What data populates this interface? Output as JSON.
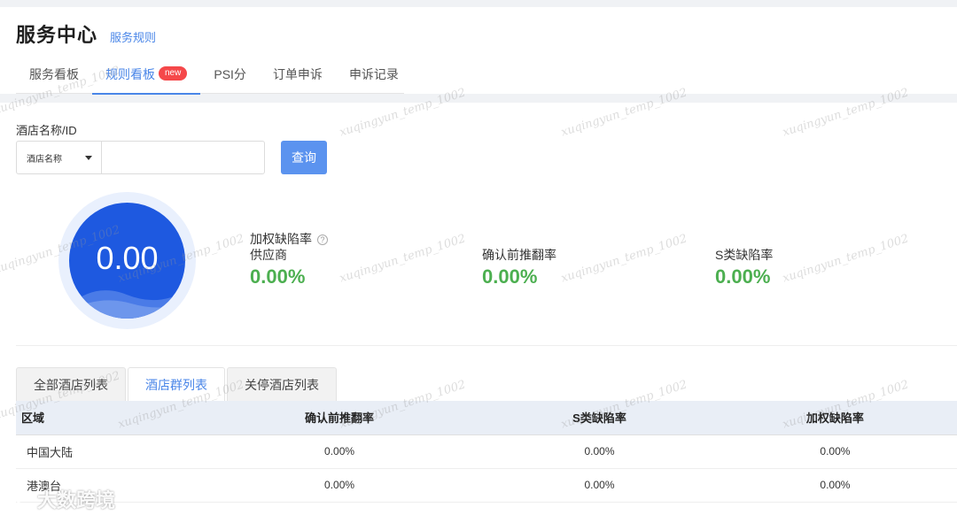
{
  "header": {
    "title": "服务中心",
    "rules_link": "服务规则",
    "tabs": [
      {
        "label": "服务看板"
      },
      {
        "label": "规则看板",
        "badge": "new"
      },
      {
        "label": "PSI分"
      },
      {
        "label": "订单申诉"
      },
      {
        "label": "申诉记录"
      }
    ],
    "active_tab": "规则看板"
  },
  "search": {
    "label": "酒店名称/ID",
    "select_value": "酒店名称",
    "input_value": "",
    "button_label": "查询"
  },
  "score": {
    "value": "0.00"
  },
  "metrics": {
    "weighted_title": "加权缺陷率",
    "items": [
      {
        "label": "供应商",
        "value": "0.00%"
      },
      {
        "label": "确认前推翻率",
        "value": "0.00%"
      },
      {
        "label": "S类缺陷率",
        "value": "0.00%"
      }
    ]
  },
  "sub_tabs": [
    {
      "label": "全部酒店列表"
    },
    {
      "label": "酒店群列表"
    },
    {
      "label": "关停酒店列表"
    }
  ],
  "table": {
    "headers": [
      "区域",
      "确认前推翻率",
      "S类缺陷率",
      "加权缺陷率"
    ],
    "rows": [
      [
        "中国大陆",
        "0.00%",
        "0.00%",
        "0.00%"
      ],
      [
        "港澳台",
        "0.00%",
        "0.00%",
        "0.00%"
      ]
    ]
  },
  "watermark": "xuqingyun_temp_1002",
  "footer_logo": "大数跨境",
  "colors": {
    "accent": "#4a86e8",
    "score_circle": "#1e59e0",
    "metric_green": "#4caf50",
    "badge_red": "#f5484a"
  }
}
